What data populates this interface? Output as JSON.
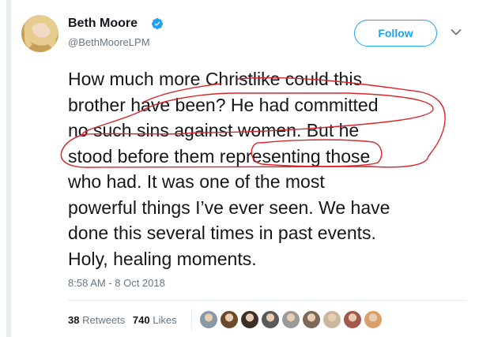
{
  "author": {
    "name": "Beth Moore",
    "handle": "@BethMooreLPM",
    "verified": true,
    "avatar_icon": "profile-photo"
  },
  "follow_button": {
    "label": "Follow"
  },
  "menu_icon": "chevron-down-icon",
  "tweet": {
    "lines": [
      "How much more Christlike could this",
      "brother have been? He had committed",
      "no such sins against women. But he",
      "stood before them representing those",
      "who had. It was one of the most",
      "powerful things I’ve ever seen. We have",
      "done this several times in past events.",
      "Holy, healing moments."
    ]
  },
  "timestamp": "8:58 AM - 8 Oct 2018",
  "stats": {
    "retweets_count": "38",
    "retweets_label": "Retweets",
    "likes_count": "740",
    "likes_label": "Likes"
  },
  "likers": [
    {
      "icon": "default-avatar",
      "color": "#8899a6"
    },
    {
      "icon": "liker-avatar",
      "color": "#6b4a2b"
    },
    {
      "icon": "liker-avatar",
      "color": "#3b2f2a"
    },
    {
      "icon": "liker-avatar",
      "color": "#5a5a5a"
    },
    {
      "icon": "liker-avatar",
      "color": "#9a9a9a"
    },
    {
      "icon": "liker-avatar",
      "color": "#7b6a5a"
    },
    {
      "icon": "liker-avatar",
      "color": "#c9b8a0"
    },
    {
      "icon": "liker-avatar",
      "color": "#a25a4a"
    },
    {
      "icon": "liker-avatar",
      "color": "#d9a06a"
    }
  ],
  "colors": {
    "accent": "#1da1f2",
    "annotation": "#d9262b",
    "text": "#14171a",
    "muted": "#657786"
  }
}
